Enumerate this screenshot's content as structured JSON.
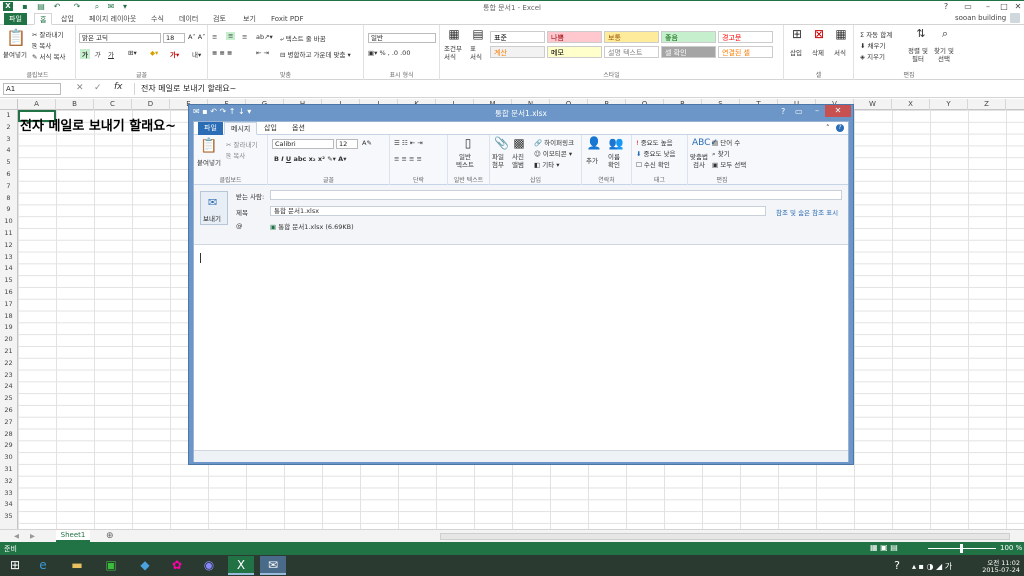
{
  "excel": {
    "window_title": "통합 문서1 - Excel",
    "user": "sooan building",
    "tabs": [
      "파일",
      "홈",
      "삽입",
      "페이지 레이아웃",
      "수식",
      "데이터",
      "검토",
      "보기",
      "Foxit PDF"
    ],
    "clipboard": {
      "paste": "붙여넣기",
      "cut": "잘라내기",
      "copy": "복사",
      "format_painter": "서식 복사",
      "label": "클립보드"
    },
    "font": {
      "name": "맑은 고딕",
      "size": "18",
      "label": "글꼴"
    },
    "alignment": {
      "wrap": "텍스트 줄 바꿈",
      "merge": "병합하고 가운데 맞춤",
      "label": "맞춤"
    },
    "number": {
      "format": "일반",
      "label": "표시 형식"
    },
    "styles": {
      "cond": "조건부\n서식",
      "table": "표\n서식",
      "cells": [
        {
          "text": "표준",
          "bg": "#ffffff",
          "fg": "#000000"
        },
        {
          "text": "나쁨",
          "bg": "#ffc7ce",
          "fg": "#9c0006"
        },
        {
          "text": "보통",
          "bg": "#ffeb9c",
          "fg": "#9c5700"
        },
        {
          "text": "좋음",
          "bg": "#c6efce",
          "fg": "#006100"
        },
        {
          "text": "경고문",
          "bg": "#ffffff",
          "fg": "#ff0000"
        },
        {
          "text": "계산",
          "bg": "#f2f2f2",
          "fg": "#fa7d00"
        },
        {
          "text": "메모",
          "bg": "#ffffcc",
          "fg": "#000000"
        },
        {
          "text": "설명 텍스트",
          "bg": "#ffffff",
          "fg": "#7f7f7f"
        },
        {
          "text": "셀 확인",
          "bg": "#a5a5a5",
          "fg": "#ffffff"
        },
        {
          "text": "연결된 셀",
          "bg": "#ffffff",
          "fg": "#fa7d00"
        }
      ],
      "label": "스타일"
    },
    "cells_grp": {
      "insert": "삽입",
      "delete": "삭제",
      "format": "서식",
      "label": "셀"
    },
    "editing": {
      "autosum": "자동 합계",
      "fill": "채우기",
      "clear": "지우기",
      "sort": "정렬 및\n필터",
      "find": "찾기 및\n선택",
      "label": "편집"
    },
    "name_box": "A1",
    "formula": "전자 메일로 보내기 할래요~",
    "columns": [
      "A",
      "B",
      "C",
      "D",
      "E",
      "F",
      "G",
      "H",
      "I",
      "J",
      "K",
      "L",
      "M",
      "N",
      "O",
      "P",
      "Q",
      "R",
      "S",
      "T",
      "U",
      "V",
      "W",
      "X",
      "Y",
      "Z"
    ],
    "rows": [
      "1",
      "2",
      "3",
      "4",
      "5",
      "6",
      "7",
      "8",
      "9",
      "10",
      "11",
      "12",
      "13",
      "14",
      "15",
      "16",
      "17",
      "18",
      "19",
      "20",
      "21",
      "22",
      "23",
      "24",
      "25",
      "26",
      "27",
      "28",
      "29",
      "30",
      "31",
      "32",
      "33",
      "34",
      "35"
    ],
    "a1": "전자 메일로 보내기 할래요~",
    "sheet_tab": "Sheet1",
    "status": "준비",
    "zoom": "100 %"
  },
  "outlook": {
    "title": "통합 문서1.xlsx",
    "tabs": [
      "파일",
      "메시지",
      "삽입",
      "옵션"
    ],
    "clipboard": {
      "paste": "붙여넣기",
      "cut": "잘라내기",
      "copy": "복사",
      "label": "클립보드"
    },
    "font": {
      "name": "Calibri",
      "size": "12",
      "label": "글꼴"
    },
    "para_label": "단락",
    "plain": {
      "text": "일반\n텍스트",
      "label": "일반 텍스트"
    },
    "insert": {
      "file": "파일\n첨부",
      "photo": "사진\n앨범",
      "link": "하이퍼링크",
      "emoji": "이모티콘",
      "other": "기타",
      "label": "삽입"
    },
    "contacts": {
      "add": "추가",
      "check": "이름\n확인",
      "label": "연락처"
    },
    "tags": {
      "high": "중요도 높음",
      "low": "중요도 낮음",
      "read": "수신 확인",
      "label": "태그"
    },
    "edit": {
      "spell": "맞춤법\n검사",
      "words": "단어 수",
      "find": "찾기",
      "all": "모두 선택",
      "label": "편집"
    },
    "send": "보내기",
    "to_label": "받는 사람:",
    "subject_label": "제목",
    "subject": "통합 문서1.xlsx",
    "cc_link": "참조 및 숨은 참조 표시",
    "attachment": "통합 문서1.xlsx (6.69KB)"
  },
  "taskbar": {
    "time": "오전 11:02",
    "date": "2015-07-24"
  }
}
